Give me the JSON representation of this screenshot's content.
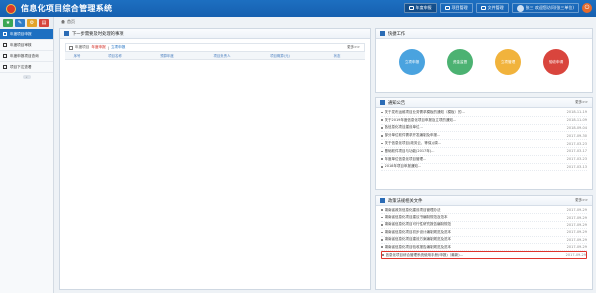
{
  "header": {
    "title": "信息化项目综合管理系统",
    "nav": [
      {
        "label": "年度申报",
        "active": true
      },
      {
        "label": "项目管理",
        "active": false
      },
      {
        "label": "文件管理",
        "active": false
      }
    ],
    "user": "张三 欢迎您访问(张三单位)",
    "logout_icon": "power-icon"
  },
  "sidebar": {
    "tools": [
      {
        "glyph": "★",
        "color": "#3aa655"
      },
      {
        "glyph": "✎",
        "color": "#2e7cc8"
      },
      {
        "glyph": "⚙",
        "color": "#e3a32a"
      },
      {
        "glyph": "▤",
        "color": "#d6443a"
      }
    ],
    "items": [
      {
        "label": "年度项目申报",
        "active": true
      },
      {
        "label": "年度项目审核",
        "active": false
      },
      {
        "label": "年度申报项目查询",
        "active": false
      },
      {
        "label": "项目下达查看",
        "active": false
      }
    ]
  },
  "breadcrumb": {
    "home": "首页"
  },
  "left_panel": {
    "title": "下一步需要及时处理的事项",
    "tab_label": "年度项目",
    "tab_red": "年度申报",
    "tab_blue": "立项申报",
    "more": "更多>>",
    "columns": [
      "序号",
      "项目名称",
      "预算年度",
      "项目负责人",
      "项目概算(元)",
      "状态"
    ]
  },
  "quick": {
    "title": "快捷工作",
    "buttons": [
      {
        "label": "立项申报",
        "color": "#4aa3df"
      },
      {
        "label": "资金监督",
        "color": "#4cb272"
      },
      {
        "label": "立项管理",
        "color": "#f1b33c"
      },
      {
        "label": "验收申请",
        "color": "#d9453d"
      }
    ]
  },
  "notices": {
    "title": "通知公告",
    "more": "更多>>",
    "items": [
      {
        "title": "关于发布运维项目业务需求模板的通知（模板）的...",
        "date": "2018-11-19"
      },
      {
        "title": "关于2019年度信息化项目申报及立项的通知...",
        "date": "2018-11-09"
      },
      {
        "title": "各信息化项目建设单位...",
        "date": "2018-09-04"
      },
      {
        "title": "部分单位软件需求开发编制及申报...",
        "date": "2017-09-30"
      },
      {
        "title": "关于信息化项目(政务云、等保)(调...",
        "date": "2017-03-23"
      },
      {
        "title": "基础软件项目与功能(2017年)...",
        "date": "2017-03-17"
      },
      {
        "title": "年度单位信息化项目管理...",
        "date": "2017-03-23"
      },
      {
        "title": "2018年项目申报通知...",
        "date": "2017-03-13"
      }
    ]
  },
  "policy": {
    "title": "政策法规相关文件",
    "more": "更多>>",
    "items": [
      {
        "title": "湖南省政务信息化建设项目管理办法",
        "date": "2017-09-29",
        "highlight": false
      },
      {
        "title": "湖南省信息化项目建议书编制规范及范本",
        "date": "2017-09-29",
        "highlight": false
      },
      {
        "title": "湖南省信息化项目可行性研究报告编制规范",
        "date": "2017-09-29",
        "highlight": false
      },
      {
        "title": "湖南省信息化项目初步设计编制规范及范本",
        "date": "2017-09-29",
        "highlight": false
      },
      {
        "title": "湖南省信息化项目建设方案编制规范及范本",
        "date": "2017-09-29",
        "highlight": false
      },
      {
        "title": "湖南省信息化项目验收报告编制规范及范本",
        "date": "2017-09-29",
        "highlight": false
      },
      {
        "title": "信息化项目综合管理系统使用手册(申报)（最新)...",
        "date": "2017-09-29",
        "highlight": true
      }
    ]
  }
}
